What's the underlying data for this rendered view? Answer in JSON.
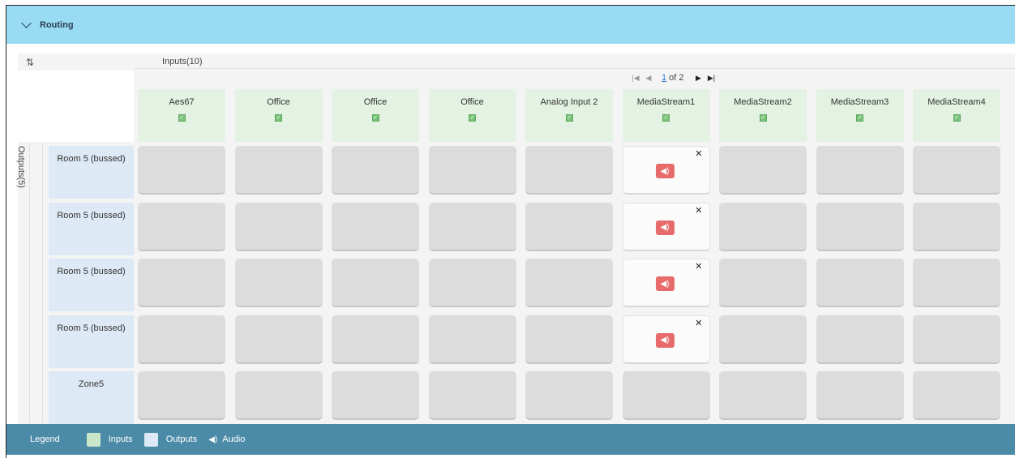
{
  "routing": {
    "title": "Routing"
  },
  "inputs": {
    "title": "Inputs(10)"
  },
  "outputs": {
    "title": "Outputs(5)"
  },
  "pager": {
    "current": "1",
    "of_text": "of 2"
  },
  "input_headers": [
    "Aes67",
    "Office",
    "Office",
    "Office",
    "Analog Input 2",
    "MediaStream1",
    "MediaStream2",
    "MediaStream3",
    "MediaStream4"
  ],
  "output_headers": [
    "Room 5 (bussed)",
    "Room 5 (bussed)",
    "Room 5 (bussed)",
    "Room 5 (bussed)",
    "Zone5"
  ],
  "routed_column": 5,
  "routed_rows": [
    0,
    1,
    2,
    3
  ],
  "legend": {
    "title": "Legend",
    "inputs": "Inputs",
    "outputs": "Outputs",
    "audio": "Audio",
    "inputs_color": "#c9e6c9",
    "outputs_color": "#dde9f4"
  },
  "icons": {
    "collapse": "chevron-down-icon",
    "refresh": "refresh-icon",
    "audio": "speaker-icon",
    "remove": "close-icon",
    "checkbox": "checkbox-checked-icon"
  }
}
